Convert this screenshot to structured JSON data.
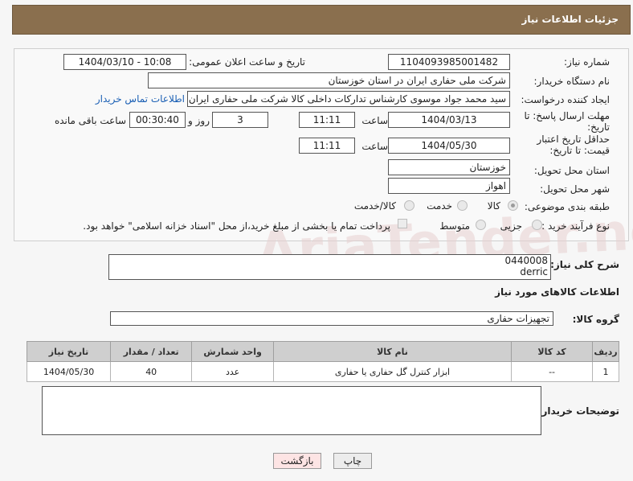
{
  "header": {
    "title": "جزئیات اطلاعات نیاز"
  },
  "form": {
    "need_number_label": "شماره نیاز:",
    "need_number": "1104093985001482",
    "announce_label": "تاریخ و ساعت اعلان عمومی:",
    "announce_value": "1404/03/10 - 10:08",
    "buyer_org_label": "نام دستگاه خریدار:",
    "buyer_org": "شرکت ملی حفاری ایران در استان خوزستان",
    "creator_label": "ایجاد کننده درخواست:",
    "creator": "سید محمد جواد موسوی کارشناس تدارکات داخلی کالا شرکت ملی حفاری ایران",
    "contact_link": "اطلاعات تماس خریدار",
    "reply_deadline_label": "مهلت ارسال پاسخ: تا تاریخ:",
    "reply_date": "1404/03/13",
    "time_label": "ساعت",
    "reply_time": "11:11",
    "days": "3",
    "days_label": "روز و",
    "remaining": "00:30:40",
    "remaining_label": "ساعت باقی مانده",
    "price_validity_label": "حداقل تاریخ اعتبار قیمت: تا تاریخ:",
    "price_date": "1404/05/30",
    "price_time": "11:11",
    "province_label": "استان محل تحویل:",
    "province": "خوزستان",
    "city_label": "شهر محل تحویل:",
    "city": "اهواز",
    "category_label": "طبقه بندی موضوعی:",
    "category_options": [
      "کالا",
      "خدمت",
      "کالا/خدمت"
    ],
    "category_selected": "کالا",
    "process_label": "نوع فرآیند خرید :",
    "process_options": [
      "جزیی",
      "متوسط"
    ],
    "payment_note": "پرداخت تمام یا بخشی از مبلغ خرید،از محل \"اسناد خزانه اسلامی\" خواهد بود."
  },
  "description": {
    "label": "شرح کلی نیاز:",
    "line1": "0440008",
    "line2": "derric"
  },
  "goods_section_title": "اطلاعات کالاهای مورد نیاز",
  "goods_group": {
    "label": "گروه کالا:",
    "value": "تجهیزات حفاری"
  },
  "table": {
    "headers": [
      "ردیف",
      "کد کالا",
      "نام کالا",
      "واحد شمارش",
      "تعداد / مقدار",
      "تاریخ نیاز"
    ],
    "rows": [
      [
        "1",
        "--",
        "ابزار کنترل گل حفاری یا حفاری",
        "عدد",
        "40",
        "1404/05/30"
      ]
    ]
  },
  "buyer_notes_label": "توضیحات خریدار:",
  "buttons": {
    "print": "چاپ",
    "back": "بازگشت"
  },
  "watermark": "AriaTender.neT"
}
